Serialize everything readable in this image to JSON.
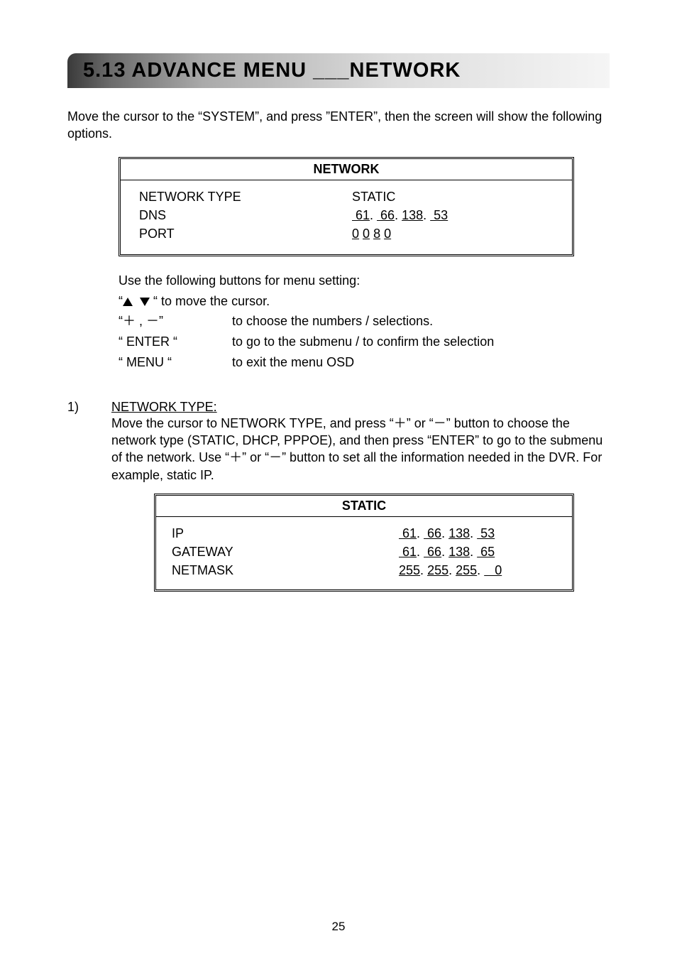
{
  "heading": "5.13 ADVANCE MENU ___NETWORK",
  "intro": "Move the cursor to the “SYSTEM”, and press ”ENTER”, then the screen will show the following options.",
  "network_panel": {
    "title": "NETWORK",
    "rows": {
      "network_type": {
        "label": "NETWORK TYPE",
        "value": "STATIC"
      },
      "dns": {
        "label": "DNS",
        "value_parts": {
          "a": " 61",
          "dot1": ". ",
          "b": " 66",
          "dot2": ". ",
          "c": "138",
          "dot3": ". ",
          "d": " 53"
        }
      },
      "port": {
        "label": "PORT",
        "value_parts": {
          "a": "0",
          "b": "0",
          "c": "8",
          "d": "0"
        }
      }
    }
  },
  "instructions": {
    "line1": "Use the following buttons for menu setting:",
    "cursor_key_prefix": "“",
    "cursor_key_suffix": " “ to move the cursor.",
    "plusminus": {
      "key": "“＋ , －”",
      "desc": "to choose the numbers / selections."
    },
    "enter": {
      "key": "“ ENTER “",
      "desc": "to go to the submenu / to confirm the selection"
    },
    "menu": {
      "key": "“ MENU “",
      "desc": " to exit the menu OSD"
    }
  },
  "section1": {
    "num": "1)",
    "title": "NETWORK TYPE:",
    "body": "Move the cursor to NETWORK TYPE, and press “＋” or “－” button to choose the network type (STATIC, DHCP, PPPOE), and then press “ENTER” to go to the submenu of the network. Use “＋” or “－” button to set all the information needed in the DVR. For example, static IP."
  },
  "static_panel": {
    "title": "STATIC",
    "rows": {
      "ip": {
        "label": "IP",
        "value_parts": {
          "a": " 61",
          "b": " 66",
          "c": "138",
          "d": " 53"
        }
      },
      "gateway": {
        "label": "GATEWAY",
        "value_parts": {
          "a": " 61",
          "b": " 66",
          "c": "138",
          "d": " 65"
        }
      },
      "netmask": {
        "label": "NETMASK",
        "value_parts": {
          "a": "255",
          "b": "255",
          "c": "255",
          "d": "   0"
        }
      }
    }
  },
  "page_number": "25"
}
